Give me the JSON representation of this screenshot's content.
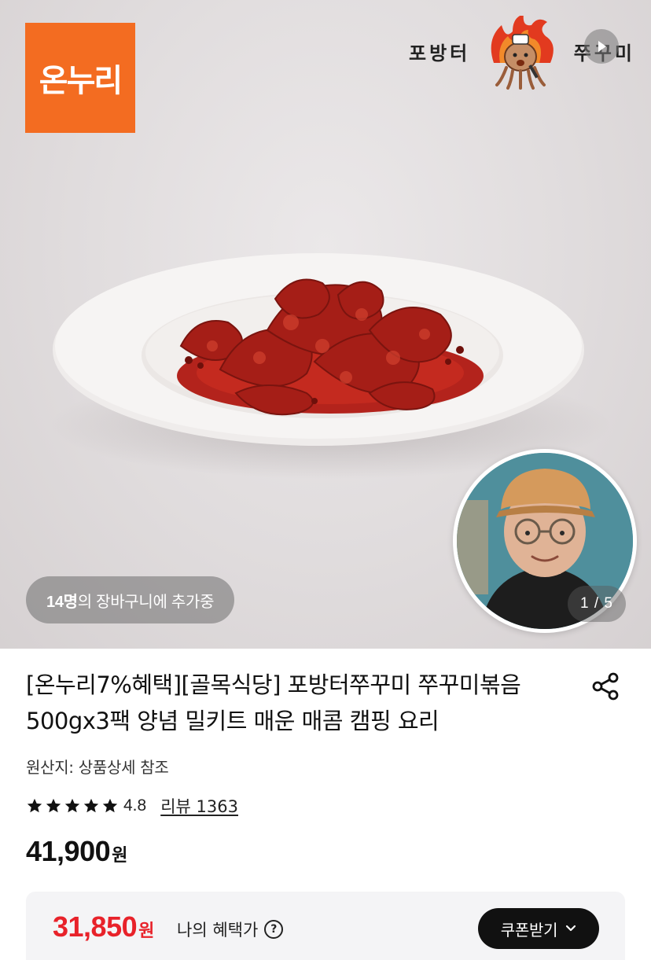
{
  "hero": {
    "logo_text": "온누리",
    "store_brand": {
      "left_text": "포방터",
      "right_text": "쭈꾸미"
    },
    "cart_count": "14명",
    "cart_suffix": "의 장바구니에 추가중",
    "page_counter": "1 / 5",
    "colors": {
      "logo_bg": "#f36c21",
      "sauce": "#b3231c"
    }
  },
  "product": {
    "title": "[온누리7%혜택][골목식당] 포방터쭈꾸미 쭈꾸미볶음 500gx3팩 양념 밀키트 매운 매콤 캠핑 요리",
    "origin": "원산지: 상품상세 참조",
    "rating": "4.8",
    "rating_stars": 5,
    "review_link": "리뷰 1363",
    "price": "41,900",
    "price_unit": "원"
  },
  "benefit": {
    "price": "31,850",
    "price_unit": "원",
    "label": "나의 혜택가",
    "help_symbol": "?",
    "coupon_button": "쿠폰받기",
    "accent_color": "#e8222a"
  }
}
